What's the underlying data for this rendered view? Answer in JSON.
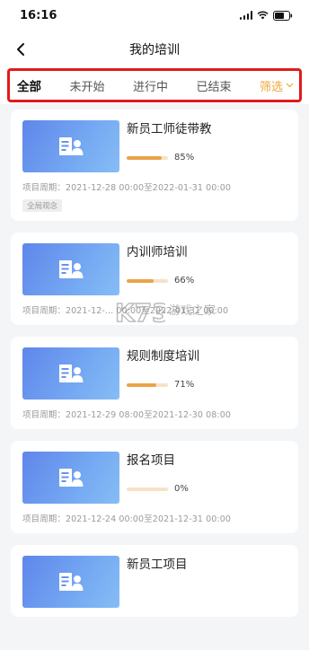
{
  "status_bar": {
    "time": "16:16"
  },
  "nav": {
    "title": "我的培训"
  },
  "tabs": [
    {
      "label": "全部",
      "active": true
    },
    {
      "label": "未开始",
      "active": false
    },
    {
      "label": "进行中",
      "active": false
    },
    {
      "label": "已结束",
      "active": false
    }
  ],
  "filter": {
    "label": "筛选"
  },
  "accent_color": "#f0a53a",
  "highlight_color": "#e01b1b",
  "courses": [
    {
      "title": "新员工师徒带教",
      "progress_pct": 85,
      "progress_label": "85%",
      "period": "项目周期：2021-12-28 00:00至2022-01-31 00:00",
      "tag": "全局观念"
    },
    {
      "title": "内训师培训",
      "progress_pct": 66,
      "progress_label": "66%",
      "period": "项目周期：2021-12-... 00:00至2022-01-31 00:00"
    },
    {
      "title": "规则制度培训",
      "progress_pct": 71,
      "progress_label": "71%",
      "period": "项目周期：2021-12-29 08:00至2021-12-30 08:00"
    },
    {
      "title": "报名项目",
      "progress_pct": 0,
      "progress_label": "0%",
      "period": "项目周期：2021-12-24 00:00至2021-12-31 00:00"
    },
    {
      "title": "新员工项目"
    }
  ],
  "watermark": {
    "logo": "K73",
    "text": "游戏之家"
  }
}
